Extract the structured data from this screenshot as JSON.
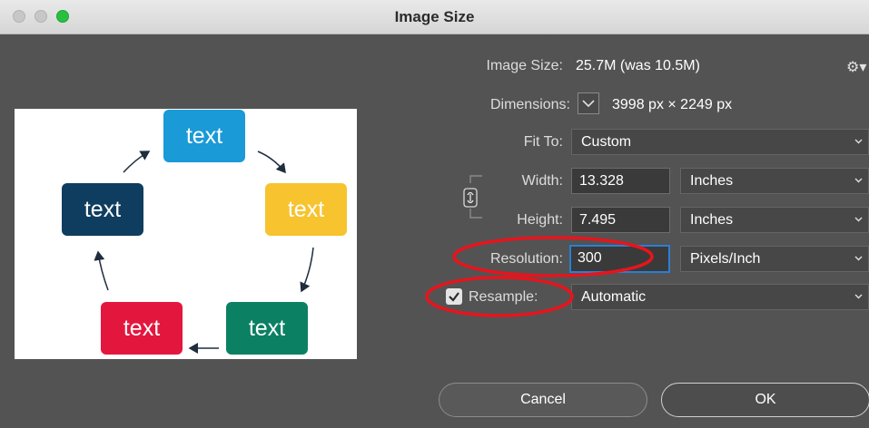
{
  "window": {
    "title": "Image Size"
  },
  "preview": {
    "boxes": [
      {
        "label": "text",
        "color": "#1a9ad6"
      },
      {
        "label": "text",
        "color": "#f7c32e"
      },
      {
        "label": "text",
        "color": "#0b8063"
      },
      {
        "label": "text",
        "color": "#e3173e"
      },
      {
        "label": "text",
        "color": "#0f3d5f"
      }
    ]
  },
  "image_size": {
    "label": "Image Size:",
    "value": "25.7M (was 10.5M)"
  },
  "dimensions": {
    "label": "Dimensions:",
    "value": "3998 px  ×  2249 px"
  },
  "fit_to": {
    "label": "Fit To:",
    "value": "Custom"
  },
  "width": {
    "label": "Width:",
    "value": "13.328",
    "unit": "Inches"
  },
  "height": {
    "label": "Height:",
    "value": "7.495",
    "unit": "Inches"
  },
  "resolution": {
    "label": "Resolution:",
    "value": "300",
    "unit": "Pixels/Inch"
  },
  "resample": {
    "label": "Resample:",
    "value": "Automatic",
    "checked": true
  },
  "buttons": {
    "cancel": "Cancel",
    "ok": "OK"
  },
  "annotation_color": "#e8141c",
  "accent_color": "#2a7fd6",
  "icons": {
    "settings": "gear-icon",
    "link": "chain-link-icon"
  }
}
